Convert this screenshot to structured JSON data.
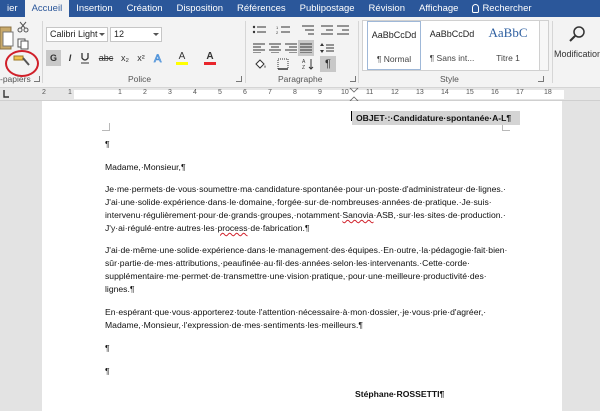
{
  "ribbon_tabs": [
    {
      "label": "ier",
      "active": false
    },
    {
      "label": "Accueil",
      "active": true
    },
    {
      "label": "Insertion",
      "active": false
    },
    {
      "label": "Création",
      "active": false
    },
    {
      "label": "Disposition",
      "active": false
    },
    {
      "label": "Références",
      "active": false
    },
    {
      "label": "Publipostage",
      "active": false
    },
    {
      "label": "Révision",
      "active": false
    },
    {
      "label": "Affichage",
      "active": false
    }
  ],
  "search": {
    "label": "Rechercher"
  },
  "clipboard": {
    "group_label": "-papiers"
  },
  "font": {
    "group_label": "Police",
    "name": "Calibri Light",
    "size": "12",
    "bold": "G",
    "italic": "I",
    "strike": "abc",
    "subscript": "x₂",
    "superscript": "x²",
    "highlight": "A",
    "color": "A"
  },
  "paragraph": {
    "group_label": "Paragraphe",
    "show_marks": "¶"
  },
  "styles": {
    "group_label": "Style",
    "items": [
      {
        "sample": "AaBbCcDd",
        "name": "¶ Normal"
      },
      {
        "sample": "AaBbCcDd",
        "name": "¶ Sans int..."
      },
      {
        "sample": "AaBbC",
        "name": "Titre 1"
      }
    ]
  },
  "editing": {
    "label": "Modification"
  },
  "ruler": {
    "marks_left": [
      "2",
      "1"
    ],
    "marks_right": [
      "1",
      "2",
      "3",
      "4",
      "5",
      "6",
      "7",
      "8",
      "9",
      "10",
      "11",
      "12",
      "13",
      "14",
      "15",
      "16",
      "17",
      "18"
    ]
  },
  "document": {
    "objet": "OBJET·:·Candidature·spontanée·A-L¶",
    "blank1": "¶",
    "salutation": "Madame,·Monsieur,¶",
    "p1": [
      "Je·me·permets·de·vous·soumettre·ma·candidature·spontanée·pour·un·poste·d'administrateur·de·lignes.·",
      "J'ai·une·solide·expérience·dans·le·domaine,·forgée·sur·de·nombreuses·années·de·pratique.·Je·suis·",
      "intervenu·régulièrement·pour·de·grands·groupes,·notamment·Sanovia·ASB,·sur·les·sites·de·production.·",
      "J'y·ai·régulé·entre·autres·les·process·de·fabrication.¶"
    ],
    "p2": [
      "J'ai·de·même·une·solide·expérience·dans·le·management·des·équipes.·En·outre,·la·pédagogie·fait·bien·",
      "sûr·partie·de·mes·attributions,·peaufinée·au·fil·des·années·selon·les·intervenants.·Cette·corde·",
      "supplémentaire·me·permet·de·transmettre·une·vision·pratique,·pour·une·meilleure·productivité·des·",
      "lignes.¶"
    ],
    "p3": [
      "En·espérant·que·vous·apporterez·toute·l'attention·nécessaire·à·mon·dossier,·je·vous·prie·d'agréer,·",
      "Madame,·Monsieur,·l'expression·de·mes·sentiments·les·meilleurs.¶"
    ],
    "blank2": "¶",
    "blank3": "¶",
    "signature": "Stéphane·ROSSETTI¶"
  },
  "colors": {
    "ribbon_blue": "#2b579a",
    "highlight_yellow": "#ffff00",
    "font_red": "#e8252b",
    "circle_red": "#d0202a"
  }
}
